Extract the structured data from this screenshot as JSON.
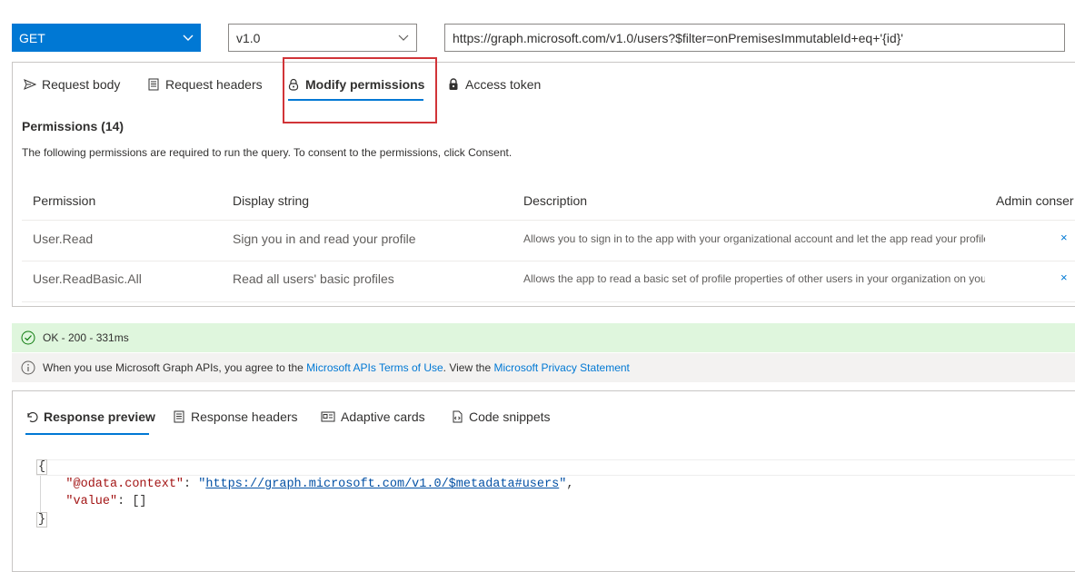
{
  "query": {
    "method": "GET",
    "version": "v1.0",
    "url": "https://graph.microsoft.com/v1.0/users?$filter=onPremisesImmutableId+eq+'{id}'"
  },
  "request_tabs": [
    {
      "label": "Request body",
      "icon": "send-icon"
    },
    {
      "label": "Request headers",
      "icon": "document-icon"
    },
    {
      "label": "Modify permissions",
      "icon": "lock-icon",
      "active": true
    },
    {
      "label": "Access token",
      "icon": "shield-icon"
    }
  ],
  "permissions": {
    "title": "Permissions (14)",
    "description": "The following permissions are required to run the query. To consent to the permissions, click Consent.",
    "columns": [
      "Permission",
      "Display string",
      "Description",
      "Admin consent required"
    ],
    "visible_columns": [
      "Permission",
      "Display string",
      "Description",
      "Admin conser"
    ],
    "rows": [
      {
        "permission": "User.Read",
        "display": "Sign you in and read your profile",
        "description": "Allows you to sign in to the app with your organizational account and let the app read your profile.",
        "admin": "×"
      },
      {
        "permission": "User.ReadBasic.All",
        "display": "Read all users' basic profiles",
        "description": "Allows the app to read a basic set of profile properties of other users in your organization on your behalf.",
        "admin": "×"
      }
    ]
  },
  "status": {
    "ok_text": "OK - 200 - 331ms",
    "info_prefix": "When you use Microsoft Graph APIs, you agree to the",
    "terms_link": "Microsoft APIs Terms of Use",
    "info_middle": ". View the",
    "privacy_link": "Microsoft Privacy Statement"
  },
  "response_tabs": [
    {
      "label": "Response preview",
      "icon": "undo-icon",
      "active": true
    },
    {
      "label": "Response headers",
      "icon": "document-icon"
    },
    {
      "label": "Adaptive cards",
      "icon": "card-icon"
    },
    {
      "label": "Code snippets",
      "icon": "code-icon"
    }
  ],
  "response": {
    "open_brace": "{",
    "close_brace": "}",
    "context_key": "\"@odata.context\"",
    "context_value": "https://graph.microsoft.com/v1.0/$metadata#users",
    "value_key": "\"value\"",
    "value_value": "[]"
  },
  "colors": {
    "accent": "#0078d4",
    "highlight": "#d13438",
    "success_bg": "#dff6dd",
    "success_icon": "#107c10"
  }
}
